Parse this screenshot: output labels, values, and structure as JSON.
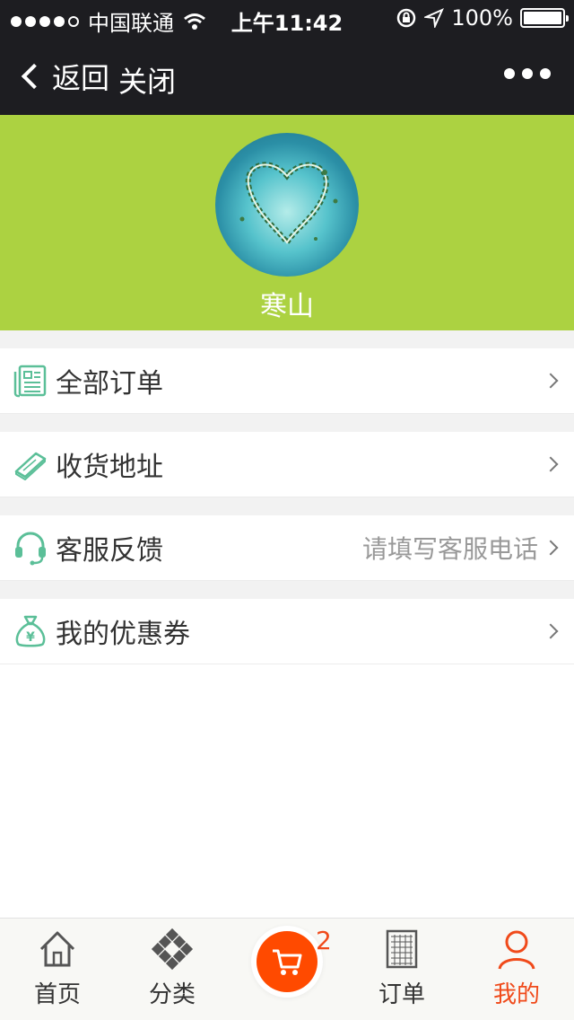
{
  "status_bar": {
    "carrier": "中国联通",
    "time": "上午11:42",
    "battery": "100%"
  },
  "nav": {
    "back_label": "返回",
    "close_label": "关闭"
  },
  "profile": {
    "username": "寒山"
  },
  "menu": {
    "items": [
      {
        "label": "全部订单",
        "icon": "order-list-icon"
      },
      {
        "label": "收货地址",
        "icon": "address-icon"
      },
      {
        "label": "客服反馈",
        "icon": "headset-icon",
        "extra": "请填写客服电话"
      },
      {
        "label": "我的优惠券",
        "icon": "coupon-bag-icon"
      }
    ]
  },
  "tabbar": {
    "home": "首页",
    "category": "分类",
    "cart_count": "2",
    "orders": "订单",
    "mine": "我的"
  },
  "colors": {
    "header_green": "#acd241",
    "accent_orange": "#f04a1a",
    "icon_teal": "#5bbf98",
    "nav_dark": "#1d1d21"
  }
}
